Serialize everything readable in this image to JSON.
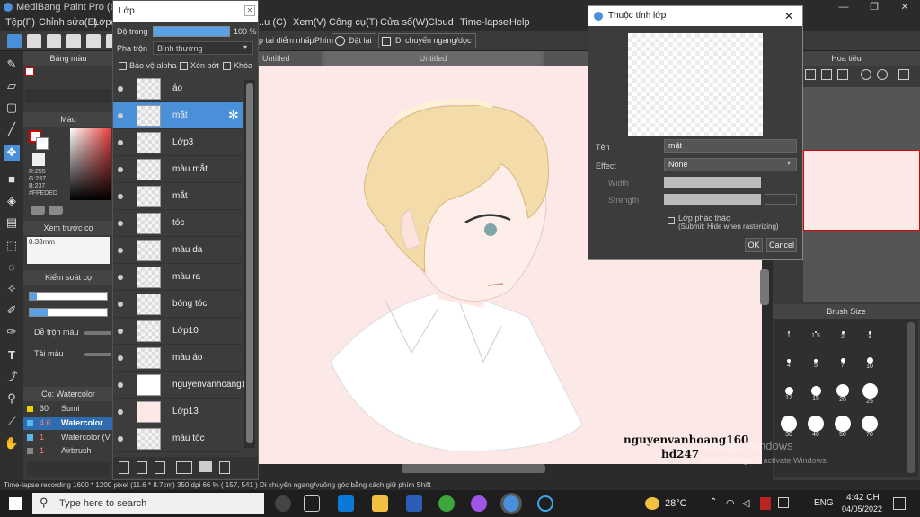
{
  "app": {
    "title": "MediBang Paint Pro (64bit)"
  },
  "menu": [
    "Tệp(F)",
    "Chỉnh sửa(E)",
    "Lớp(L)",
    "...u (C)",
    "Xem(V)",
    "Công cụ(T)",
    "Cửa sổ(W)",
    "Cloud",
    "Time-lapse",
    "Help"
  ],
  "toolbar": {
    "snap_label": "p tại điểm nhấp",
    "phim_label": "Phím",
    "reset_label": "Đặt lại",
    "move_label": "Di chuyển ngang/dọc"
  },
  "doc_tabs": [
    "Untitled",
    "Untitled",
    "Untitled"
  ],
  "left": {
    "color_palette": "Bảng màu",
    "color": "Màu",
    "rgb": [
      "R:255",
      "G:237",
      "B:237"
    ],
    "hex": "#FFEDED",
    "brush_preview": "Xem trước cọ",
    "brush_size_text": "0.33mm",
    "brush_control": "Kiểm soát cọ",
    "blend": "Dễ trộn màu",
    "paint": "Tải màu",
    "brush_list_head": "Cọ: Watercolor",
    "brushes": [
      {
        "n": "30",
        "name": "Sumi"
      },
      {
        "n": "4.6",
        "name": "Watercolor"
      },
      {
        "n": "1",
        "name": "Watercolor (V"
      },
      {
        "n": "1",
        "name": "Airbrush"
      }
    ]
  },
  "layers": {
    "title": "Lớp",
    "opacity_label": "Độ trong",
    "opacity_value": "100 %",
    "blend_label": "Pha trộn",
    "blend_value": "Bình thường",
    "protect_alpha": "Bảo vệ alpha",
    "clip": "Xén bớt",
    "lock": "Khóa",
    "items": [
      "áo",
      "mặt",
      "Lớp3",
      "màu mắt",
      "mắt",
      "tóc",
      "màu da",
      "màu ra",
      "bóng tóc",
      "Lớp10",
      "màu áo",
      "nguyenvanhoang16",
      "Lớp13",
      "màu tóc"
    ],
    "selected": 1
  },
  "canvas": {
    "signature_1": "nguyenvanhoang160",
    "signature_2": "hd247",
    "watermark_1": "Activate Windows",
    "watermark_2": "Go to Settings to activate Windows."
  },
  "dialog": {
    "title": "Thuộc tính lớp",
    "name_label": "Tên",
    "name_value": "mặt",
    "effect_label": "Effect",
    "effect_value": "None",
    "width_label": "Width",
    "strength_label": "Strength",
    "draft_label": "Lớp phác thảo",
    "draft_sub": "(Submit: Hide when rasterizing)",
    "ok": "OK",
    "cancel": "Cancel"
  },
  "right": {
    "navigator": "Hoa tiêu",
    "brush_size": "Brush Size",
    "sizes": [
      "1",
      "1.5",
      "2",
      "3",
      "4",
      "5",
      "7",
      "10",
      "12",
      "15",
      "20",
      "25",
      "30",
      "40",
      "50",
      "70"
    ]
  },
  "status": {
    "text": "Time-lapse recording   1600 * 1200 pixel   (11.6 * 8.7cm)   350 dpi   66 %   ( 157, 541 )   Di chuyển ngang/vuông góc bằng cách giữ phím Shift"
  },
  "taskbar": {
    "search": "Type here to search",
    "temp": "28°C",
    "lang": "ENG",
    "time": "4:42 CH",
    "date": "04/05/2022"
  }
}
